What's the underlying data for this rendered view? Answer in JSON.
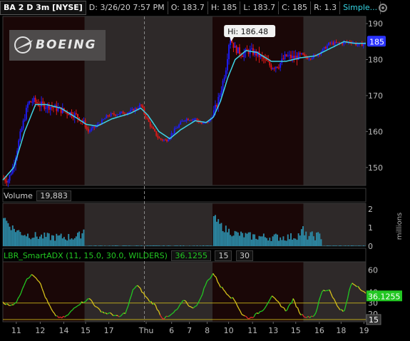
{
  "header": {
    "symbol": "BA 2 D 3m [NYSE]",
    "date": "D: 3/26/20 7:57 PM",
    "open": "O: 183.7",
    "high": "H: 185",
    "low": "L: 183.7",
    "close": "C: 185",
    "range": "R: 1.3",
    "study": "Simple..."
  },
  "price_pane": {
    "logo_text": "BOEING",
    "hi_label": "Hi: 186.48",
    "last_price_badge": "185"
  },
  "volume_pane": {
    "title": "Volume",
    "value": "19,883",
    "unit": "millions"
  },
  "adx_pane": {
    "title": "LBR_SmartADX (11, 15.0, 30.0, WILDERS)",
    "value": "36.1255",
    "level_a": "15",
    "level_b": "30",
    "last_badge": "36.1255",
    "level_badge": "15"
  },
  "colors": {
    "up": "#1d1df5",
    "down": "#e01818",
    "neutral": "#7a7a7a",
    "ma": "#3ed4e6",
    "vol": "#2c8aa6",
    "adx_up": "#22c722",
    "adx_down": "#d8c21a",
    "adx_low": "#e02a2a",
    "session_bg": "#1a0707",
    "ext_bg": "#2e2929"
  },
  "chart_data": [
    {
      "type": "candlestick",
      "title": "BA 2 D 3m [NYSE]",
      "y_ticks": [
        150,
        160,
        170,
        180,
        190
      ],
      "ylim": [
        145,
        192
      ],
      "hi_marker": 186.48,
      "last_price": 185,
      "x_labels": [
        "11",
        "12",
        "14",
        "15",
        "17",
        "Thu",
        "6",
        "7",
        "8",
        "10",
        "11",
        "13",
        "15",
        "16",
        "18",
        "19"
      ],
      "price_path": [
        [
          0,
          147.0
        ],
        [
          0.015,
          146.5
        ],
        [
          0.03,
          151
        ],
        [
          0.05,
          160
        ],
        [
          0.07,
          168
        ],
        [
          0.085,
          168.5
        ],
        [
          0.1,
          167.5
        ],
        [
          0.13,
          167
        ],
        [
          0.16,
          166
        ],
        [
          0.19,
          165
        ],
        [
          0.21,
          164
        ],
        [
          0.225,
          162
        ],
        [
          0.235,
          160
        ],
        [
          0.25,
          161
        ],
        [
          0.27,
          162.5
        ],
        [
          0.29,
          164.5
        ],
        [
          0.32,
          165
        ],
        [
          0.35,
          165.5
        ],
        [
          0.37,
          166.5
        ],
        [
          0.38,
          167.5
        ],
        [
          0.39,
          165
        ],
        [
          0.41,
          161
        ],
        [
          0.43,
          158
        ],
        [
          0.45,
          157.5
        ],
        [
          0.47,
          160
        ],
        [
          0.5,
          163.5
        ],
        [
          0.53,
          163.5
        ],
        [
          0.55,
          162
        ],
        [
          0.57,
          163
        ],
        [
          0.59,
          167.5
        ],
        [
          0.6,
          171
        ],
        [
          0.615,
          178
        ],
        [
          0.625,
          186.3
        ],
        [
          0.64,
          183
        ],
        [
          0.66,
          181.5
        ],
        [
          0.68,
          182.5
        ],
        [
          0.7,
          181.5
        ],
        [
          0.72,
          180
        ],
        [
          0.74,
          178
        ],
        [
          0.76,
          178.5
        ],
        [
          0.78,
          181
        ],
        [
          0.8,
          180.5
        ],
        [
          0.82,
          181
        ],
        [
          0.84,
          180.5
        ],
        [
          0.86,
          181
        ],
        [
          0.88,
          182.5
        ],
        [
          0.9,
          184.5
        ],
        [
          0.93,
          184.5
        ],
        [
          0.96,
          185
        ],
        [
          0.98,
          184
        ],
        [
          1.0,
          184.5
        ]
      ],
      "ma_path": [
        [
          0,
          146.5
        ],
        [
          0.03,
          150
        ],
        [
          0.06,
          160
        ],
        [
          0.09,
          167.5
        ],
        [
          0.12,
          167.5
        ],
        [
          0.16,
          166.5
        ],
        [
          0.2,
          164
        ],
        [
          0.23,
          162
        ],
        [
          0.26,
          161.5
        ],
        [
          0.3,
          163.5
        ],
        [
          0.35,
          165
        ],
        [
          0.38,
          166.5
        ],
        [
          0.4,
          164.5
        ],
        [
          0.43,
          160
        ],
        [
          0.46,
          158
        ],
        [
          0.49,
          160.5
        ],
        [
          0.53,
          163
        ],
        [
          0.56,
          162.5
        ],
        [
          0.58,
          164
        ],
        [
          0.6,
          168.5
        ],
        [
          0.62,
          175
        ],
        [
          0.64,
          180
        ],
        [
          0.67,
          182.5
        ],
        [
          0.7,
          182
        ],
        [
          0.74,
          179.5
        ],
        [
          0.78,
          179.5
        ],
        [
          0.82,
          180.5
        ],
        [
          0.86,
          181
        ],
        [
          0.9,
          183
        ],
        [
          0.94,
          185
        ],
        [
          0.97,
          184.5
        ],
        [
          1.0,
          184.5
        ]
      ]
    },
    {
      "type": "bar",
      "title": "Volume",
      "unit": "millions",
      "y_ticks": [
        0,
        1,
        2
      ],
      "ylim": [
        0,
        2.3
      ],
      "last_value": 19883
    },
    {
      "type": "line",
      "title": "LBR_SmartADX",
      "y_ticks": [
        20,
        30,
        40,
        60
      ],
      "ylim": [
        13,
        68
      ],
      "levels": [
        15,
        30
      ],
      "last_value": 36.1255,
      "adx_path": [
        [
          0,
          31
        ],
        [
          0.02,
          27
        ],
        [
          0.04,
          32
        ],
        [
          0.06,
          48
        ],
        [
          0.08,
          57
        ],
        [
          0.1,
          50
        ],
        [
          0.12,
          33
        ],
        [
          0.14,
          20
        ],
        [
          0.16,
          16
        ],
        [
          0.18,
          19
        ],
        [
          0.2,
          27
        ],
        [
          0.22,
          31
        ],
        [
          0.24,
          34
        ],
        [
          0.26,
          25
        ],
        [
          0.28,
          21
        ],
        [
          0.3,
          20
        ],
        [
          0.32,
          17
        ],
        [
          0.34,
          22
        ],
        [
          0.36,
          43
        ],
        [
          0.37,
          46
        ],
        [
          0.38,
          42
        ],
        [
          0.4,
          33
        ],
        [
          0.42,
          28
        ],
        [
          0.44,
          16
        ],
        [
          0.46,
          18
        ],
        [
          0.48,
          24
        ],
        [
          0.5,
          33
        ],
        [
          0.52,
          25
        ],
        [
          0.54,
          30
        ],
        [
          0.56,
          48
        ],
        [
          0.58,
          57
        ],
        [
          0.6,
          45
        ],
        [
          0.62,
          38
        ],
        [
          0.64,
          32
        ],
        [
          0.66,
          19
        ],
        [
          0.68,
          16
        ],
        [
          0.7,
          20
        ],
        [
          0.72,
          25
        ],
        [
          0.74,
          36
        ],
        [
          0.76,
          30
        ],
        [
          0.78,
          23
        ],
        [
          0.8,
          33
        ],
        [
          0.82,
          20
        ],
        [
          0.84,
          17
        ],
        [
          0.86,
          19
        ],
        [
          0.88,
          41
        ],
        [
          0.9,
          42
        ],
        [
          0.92,
          28
        ],
        [
          0.94,
          21
        ],
        [
          0.96,
          48
        ],
        [
          0.98,
          45
        ],
        [
          1.0,
          38
        ]
      ]
    }
  ]
}
